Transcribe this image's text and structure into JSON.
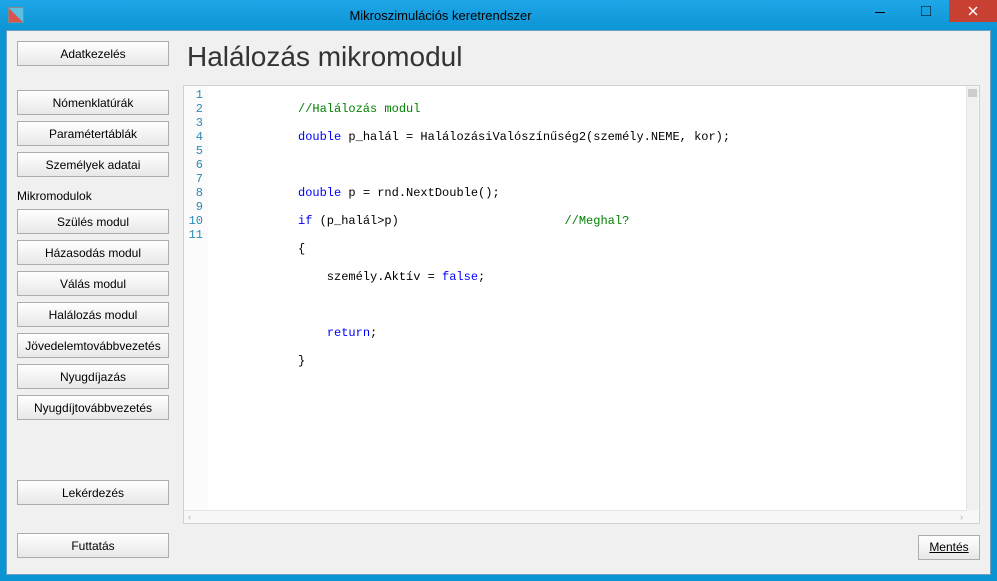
{
  "window": {
    "title": "Mikroszimulációs keretrendszer"
  },
  "sidebar": {
    "data_mgmt": "Adatkezelés",
    "nomenclatures": "Nómenklatúrák",
    "param_tables": "Paramétertáblák",
    "persons": "Személyek adatai",
    "modules_label": "Mikromodulok",
    "birth": "Szülés modul",
    "marriage": "Házasodás modul",
    "divorce": "Válás modul",
    "death": "Halálozás modul",
    "income_forward": "Jövedelemtovábbvezetés",
    "retirement": "Nyugdíjazás",
    "pension_forward": "Nyugdíjtovábbvezetés",
    "query": "Lekérdezés",
    "run": "Futtatás"
  },
  "main": {
    "title": "Halálozás mikromodul",
    "save_label": "Mentés"
  },
  "code": {
    "lines": [
      "1",
      "2",
      "3",
      "4",
      "5",
      "6",
      "7",
      "8",
      "9",
      "10",
      "11"
    ],
    "l1_comment": "//Halálozás modul",
    "l2_kw": "double",
    "l2_rest": " p_halál = HalálozásiValószínűség2(személy.NEME, kor);",
    "l4_kw": "double",
    "l4_rest": " p = rnd.NextDouble();",
    "l5_kw": "if",
    "l5_rest": " (p_halál>p)                       ",
    "l5_cm": "//Meghal?",
    "l6": "{",
    "l7_pre": "    személy.Aktív = ",
    "l7_kw": "false",
    "l7_post": ";",
    "l9_kw": "return",
    "l9_post": ";",
    "l10": "}"
  }
}
